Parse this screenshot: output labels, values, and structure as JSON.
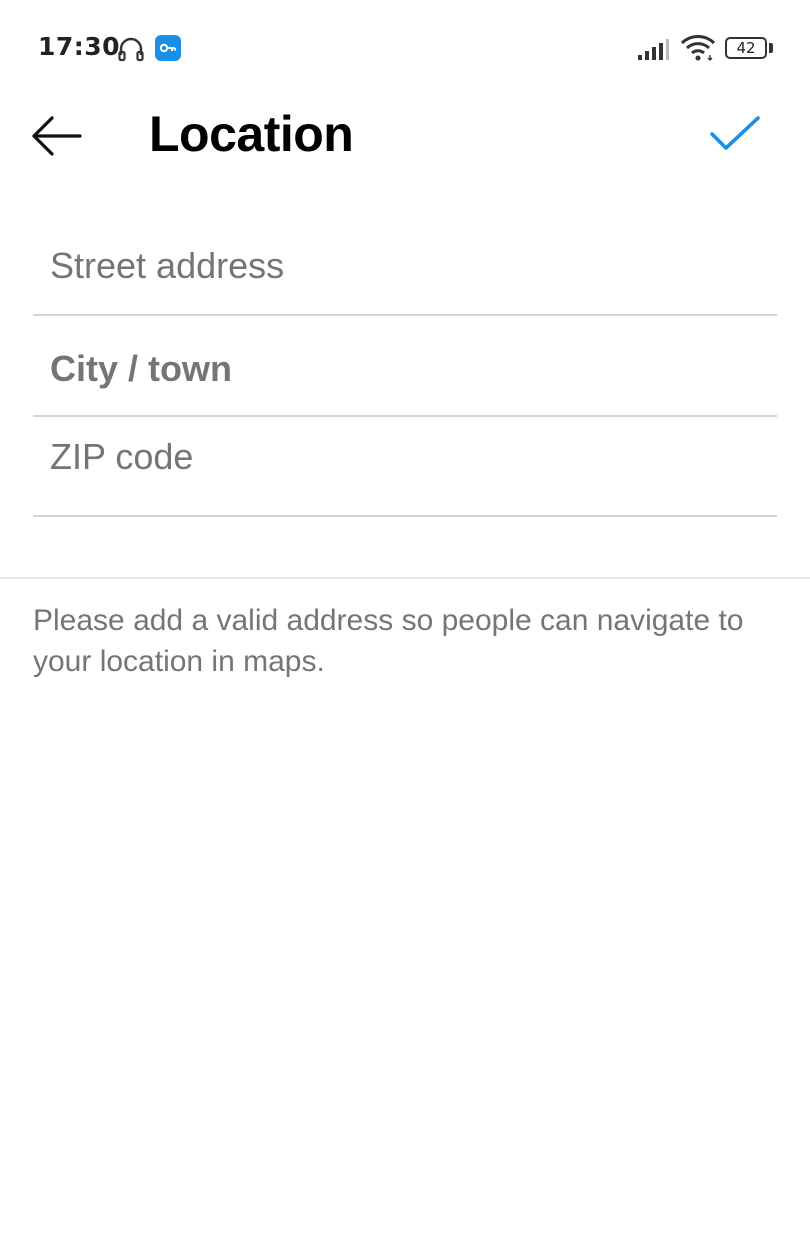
{
  "status_bar": {
    "time": "17:30",
    "battery_level": "42",
    "icons": [
      "headset-icon",
      "vpn-key-icon",
      "signal-icon",
      "wifi-icon",
      "battery-icon"
    ]
  },
  "header": {
    "title": "Location",
    "back_icon": "arrow-left-icon",
    "done_icon": "checkmark-icon",
    "accent_color": "#1a8fe8"
  },
  "form": {
    "street": {
      "placeholder": "Street address",
      "value": ""
    },
    "city": {
      "placeholder": "City / town",
      "value": ""
    },
    "zip": {
      "placeholder": "ZIP code",
      "value": ""
    }
  },
  "helper_text": "Please add a valid address so people can navigate to your location in maps."
}
